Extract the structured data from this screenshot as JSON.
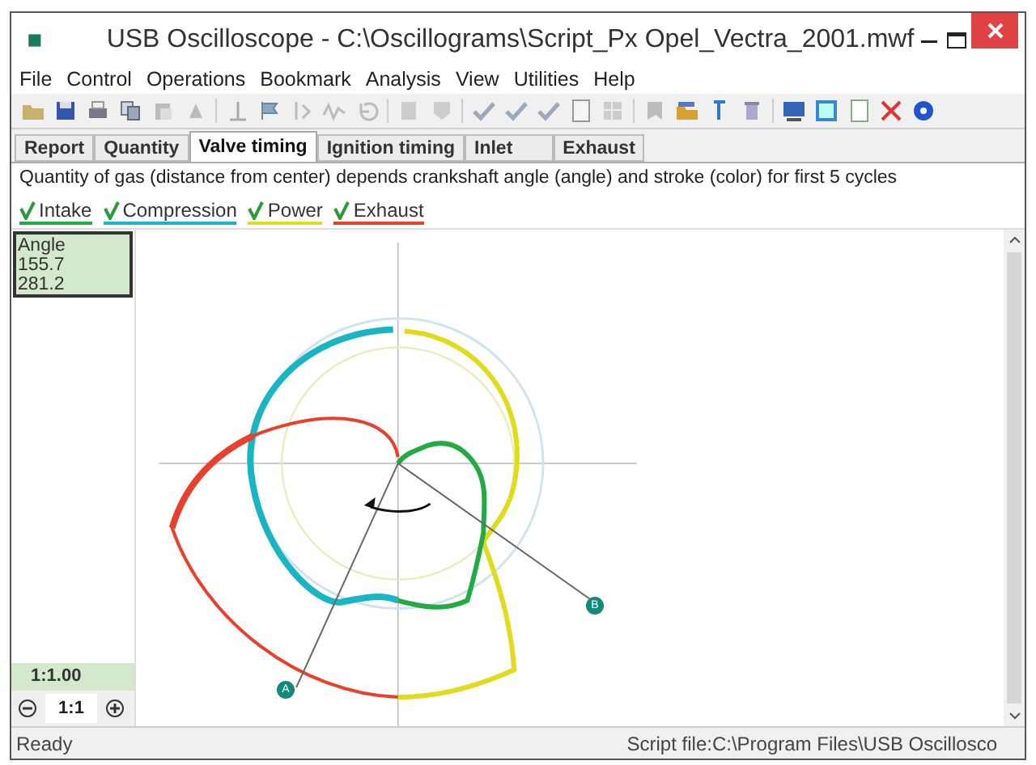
{
  "window": {
    "title": "USB Oscilloscope - C:\\Oscillograms\\Script_Px Opel_Vectra_2001.mwf"
  },
  "menu": [
    "File",
    "Control",
    "Operations",
    "Bookmark",
    "Analysis",
    "View",
    "Utilities",
    "Help"
  ],
  "tabs": [
    {
      "label": "Report",
      "selected": false
    },
    {
      "label": "Quantity",
      "selected": false
    },
    {
      "label": "Valve timing",
      "selected": true
    },
    {
      "label": "Ignition timing",
      "selected": false
    },
    {
      "label": "Inlet",
      "selected": false
    },
    {
      "label": "Exhaust",
      "selected": false
    }
  ],
  "description": "Quantity of gas (distance from center) depends crankshaft angle (angle) and stroke (color) for first 5 cycles",
  "legend": [
    {
      "label": "Intake",
      "checked": true,
      "color": "#22aa44"
    },
    {
      "label": "Compression",
      "checked": true,
      "color": "#19b5c3"
    },
    {
      "label": "Power",
      "checked": true,
      "color": "#e0dc1c"
    },
    {
      "label": "Exhaust",
      "checked": true,
      "color": "#e8402a"
    }
  ],
  "readout": {
    "title": "Angle",
    "values": [
      "155.7",
      "281.2"
    ]
  },
  "scale": "1:1.00",
  "zoom": {
    "value": "1:1"
  },
  "markers": [
    "A",
    "B"
  ],
  "status_bar": {
    "left": "Ready",
    "right": "Script file:C:\\Program Files\\USB Oscillosco"
  }
}
